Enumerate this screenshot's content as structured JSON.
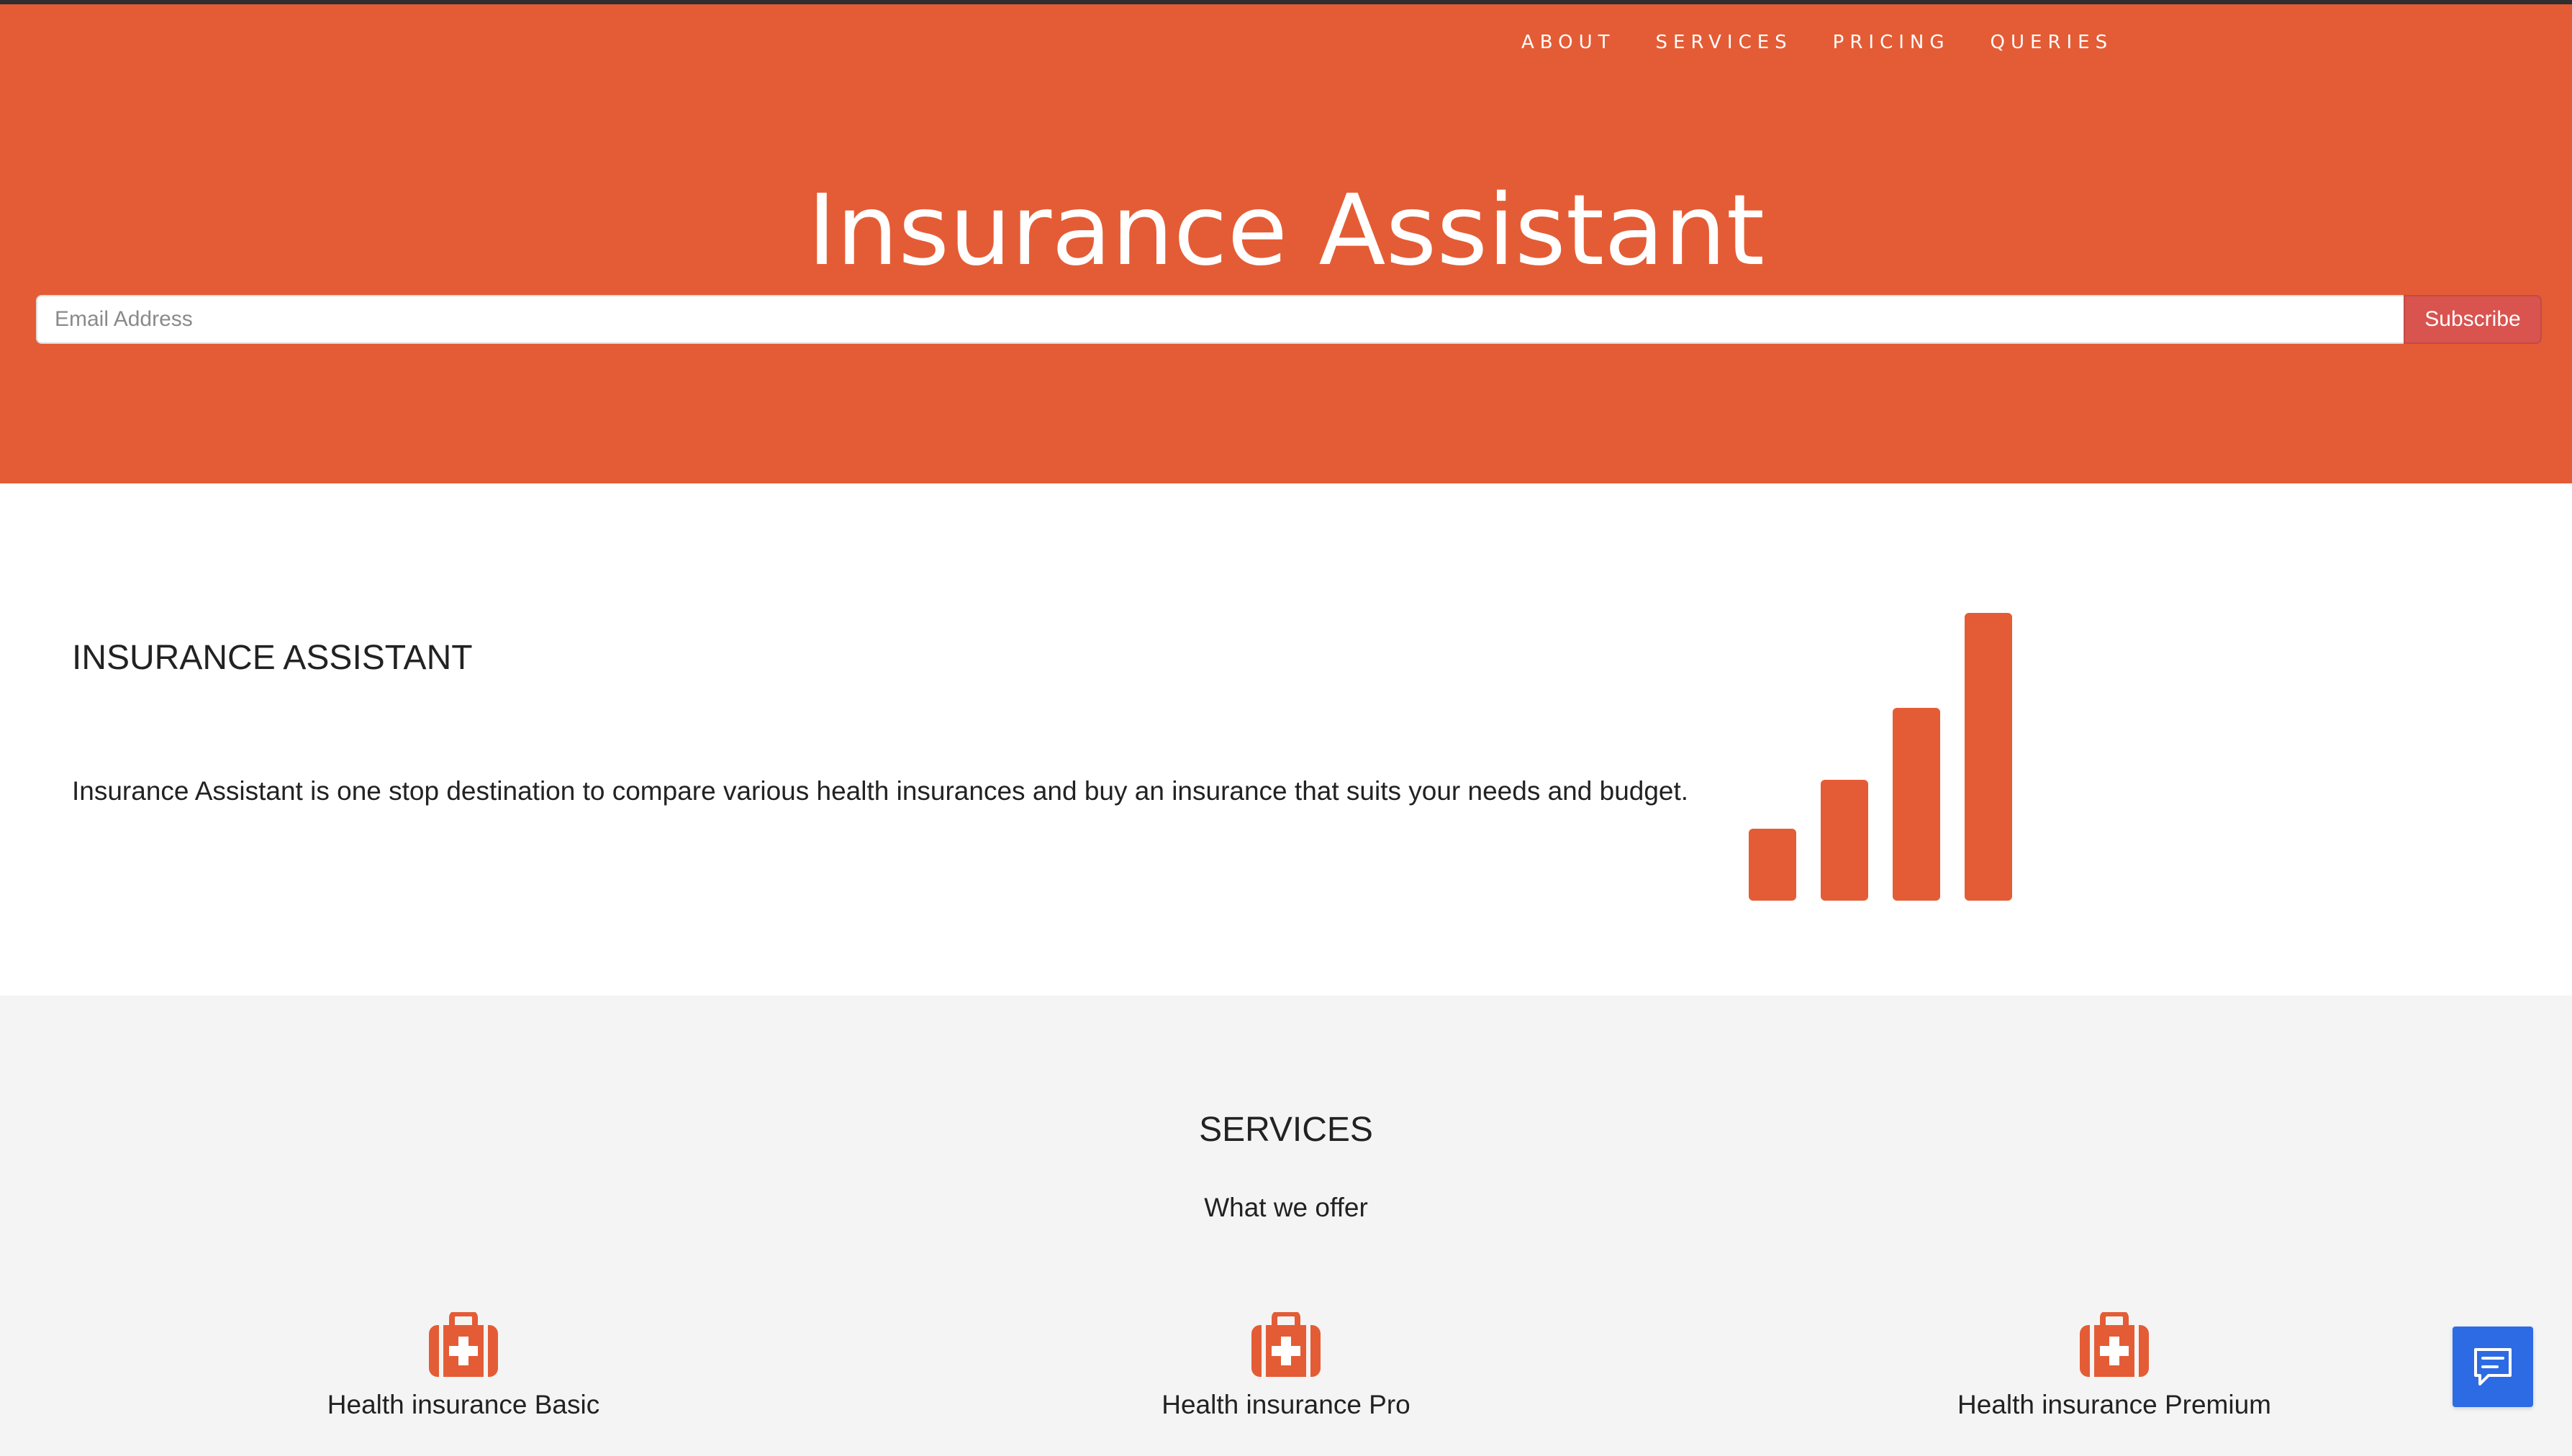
{
  "nav": {
    "items": [
      {
        "label": "ABOUT"
      },
      {
        "label": "SERVICES"
      },
      {
        "label": "PRICING"
      },
      {
        "label": "QUERIES"
      }
    ]
  },
  "hero": {
    "title": "Insurance Assistant",
    "email_placeholder": "Email Address",
    "email_value": "",
    "subscribe_label": "Subscribe"
  },
  "about": {
    "heading": "INSURANCE ASSISTANT",
    "text": "Insurance Assistant is one stop destination to compare various health insurances and buy an insurance that suits your needs and budget.",
    "icon": "signal-bars-icon"
  },
  "services": {
    "heading": "SERVICES",
    "subheading": "What we offer",
    "items": [
      {
        "label": "Health insurance Basic",
        "icon": "medical-kit-icon"
      },
      {
        "label": "Health insurance Pro",
        "icon": "medical-kit-icon"
      },
      {
        "label": "Health insurance Premium",
        "icon": "medical-kit-icon"
      }
    ]
  },
  "chat": {
    "icon": "chat-icon"
  },
  "colors": {
    "brand": "#e45c35",
    "subscribe_button": "#d9534f",
    "services_background": "#f4f4f4",
    "chat_button": "#2d6be4",
    "text": "#222222"
  }
}
